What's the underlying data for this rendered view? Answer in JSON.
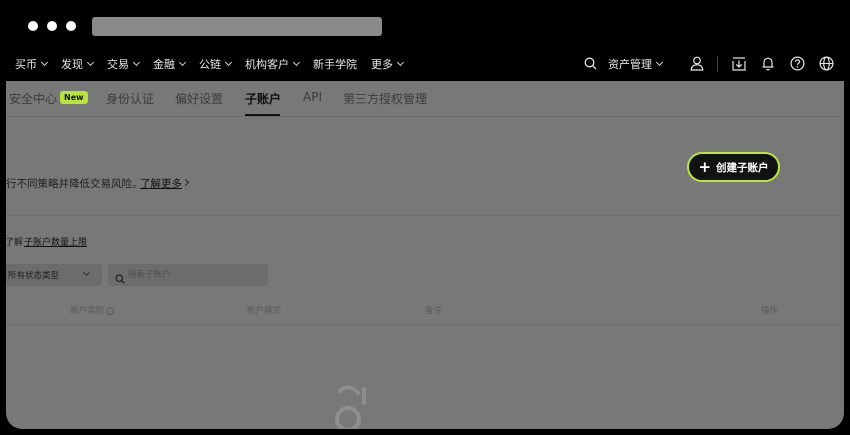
{
  "nav": {
    "items": [
      {
        "label": "买币",
        "chevron": true
      },
      {
        "label": "发现",
        "chevron": true
      },
      {
        "label": "交易",
        "chevron": true
      },
      {
        "label": "金融",
        "chevron": true
      },
      {
        "label": "公链",
        "chevron": true
      },
      {
        "label": "机构客户",
        "chevron": true
      },
      {
        "label": "新手学院",
        "chevron": false
      },
      {
        "label": "更多",
        "chevron": true
      }
    ],
    "asset_label": "资产管理",
    "icons": [
      "search-icon",
      "user-icon",
      "download-icon",
      "bell-icon",
      "help-icon",
      "globe-icon"
    ]
  },
  "tabs": {
    "security": "安全中心",
    "new_badge": "New",
    "identity": "身份认证",
    "preferences": "偏好设置",
    "subaccount": "子账户",
    "api": "API",
    "third_party": "第三方授权管理"
  },
  "intro": {
    "text": "行不同策略并降低交易风险。",
    "learn_more": "了解更多"
  },
  "create_button": {
    "label": "创建子账户"
  },
  "limit": {
    "prefix": "了解",
    "link": "子账户数量上限"
  },
  "filters": {
    "status_select": "所有状态类型",
    "search_placeholder": "搜索子账户"
  },
  "table": {
    "headers": {
      "type": "账户类别",
      "mode": "账户模式",
      "note": "备注",
      "action": "操作"
    }
  },
  "colors": {
    "accent": "#b7e63b",
    "overlay": "#787878",
    "header_bg": "#000000"
  }
}
